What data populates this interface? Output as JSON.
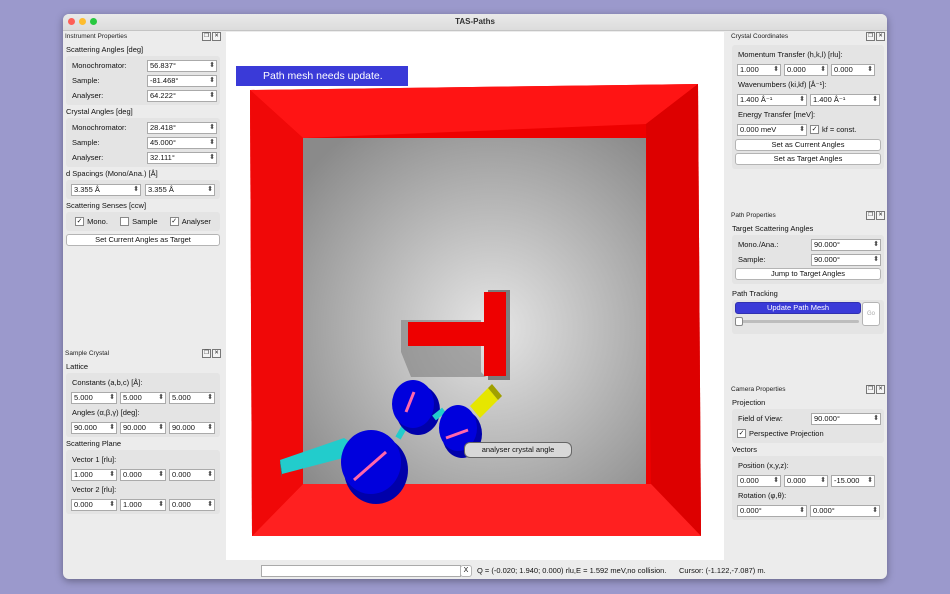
{
  "window": {
    "title": "TAS-Paths"
  },
  "instrument": {
    "dock_title": "Instrument Properties",
    "scattering_angles_title": "Scattering Angles [deg]",
    "mono_label": "Monochromator:",
    "mono_value": "56.837°",
    "sample_label": "Sample:",
    "sample_value": "-81.468°",
    "analyser_label": "Analyser:",
    "analyser_value": "64.222°",
    "crystal_angles_title": "Crystal Angles [deg]",
    "c_mono_label": "Monochromator:",
    "c_mono_value": "28.418°",
    "c_sample_label": "Sample:",
    "c_sample_value": "45.000°",
    "c_analyser_label": "Analyser:",
    "c_analyser_value": "32.111°",
    "dspacing_title": "d Spacings (Mono/Ana.) [Å]",
    "d_mono": "3.355 Å",
    "d_ana": "3.355 Å",
    "senses_title": "Scattering Senses [ccw]",
    "sense_mono": "Mono.",
    "sense_mono_checked": "✓",
    "sense_sample": "Sample",
    "sense_sample_checked": "",
    "sense_analyser": "Analyser",
    "sense_analyser_checked": "✓",
    "set_target_button": "Set Current Angles as Target"
  },
  "sample_crystal": {
    "dock_title": "Sample Crystal",
    "lattice_title": "Lattice",
    "constants_label": "Constants (a,b,c) [Å]:",
    "a": "5.000",
    "b": "5.000",
    "c": "5.000",
    "angles_label": "Angles (α,β,γ) [deg]:",
    "alpha": "90.000",
    "beta": "90.000",
    "gamma": "90.000",
    "plane_title": "Scattering Plane",
    "vec1_label": "Vector 1 [rlu]:",
    "v1x": "1.000",
    "v1y": "0.000",
    "v1z": "0.000",
    "vec2_label": "Vector 2 [rlu]:",
    "v2x": "0.000",
    "v2y": "1.000",
    "v2z": "0.000"
  },
  "crystal_coords": {
    "dock_title": "Crystal Coordinates",
    "momentum_label": "Momentum Transfer (h,k,l) [rlu]:",
    "h": "1.000",
    "k": "0.000",
    "l": "0.000",
    "wavenumbers_label": "Wavenumbers (ki,kf) [Å⁻¹]:",
    "ki": "1.400 Å⁻¹",
    "kf": "1.400 Å⁻¹",
    "energy_label": "Energy Transfer [meV]:",
    "energy": "0.000 meV",
    "kf_const_label": "kf = const.",
    "kf_const_checked": "✓",
    "set_current_button": "Set as Current Angles",
    "set_target_button": "Set as Target Angles"
  },
  "path_props": {
    "dock_title": "Path Properties",
    "target_title": "Target Scattering Angles",
    "mono_ana_label": "Mono./Ana.:",
    "mono_ana_value": "90.000°",
    "sample_label": "Sample:",
    "sample_value": "90.000°",
    "jump_button": "Jump to Target Angles",
    "tracking_title": "Path Tracking",
    "update_button": "Update Path Mesh",
    "go_button": "Go",
    "slider_value": 0
  },
  "camera": {
    "dock_title": "Camera Properties",
    "projection_title": "Projection",
    "fov_label": "Field of View:",
    "fov_value": "90.000°",
    "perspective_label": "Perspective Projection",
    "perspective_checked": "✓",
    "vectors_title": "Vectors",
    "position_label": "Position (x,y,z):",
    "px": "0.000",
    "py": "0.000",
    "pz": "-15.000",
    "rotation_label": "Rotation (φ,θ):",
    "rphi": "0.000°",
    "rtheta": "0.000°"
  },
  "viewport": {
    "banner": "Path mesh needs update.",
    "tooltip": "analyser crystal angle"
  },
  "statusbar": {
    "input_value": "",
    "clear_button": "X",
    "info": "Q = (-0.020; 1.940; 0.000) rlu,E = 1.592 meV,no collision.",
    "cursor": "Cursor: (-1.122,-7.087) m."
  },
  "colors": {
    "wall": "#ee0000",
    "accent": "#3a3ad8",
    "cyan": "#22cccc",
    "yellow": "#e6e600",
    "blue": "#0000cc"
  }
}
